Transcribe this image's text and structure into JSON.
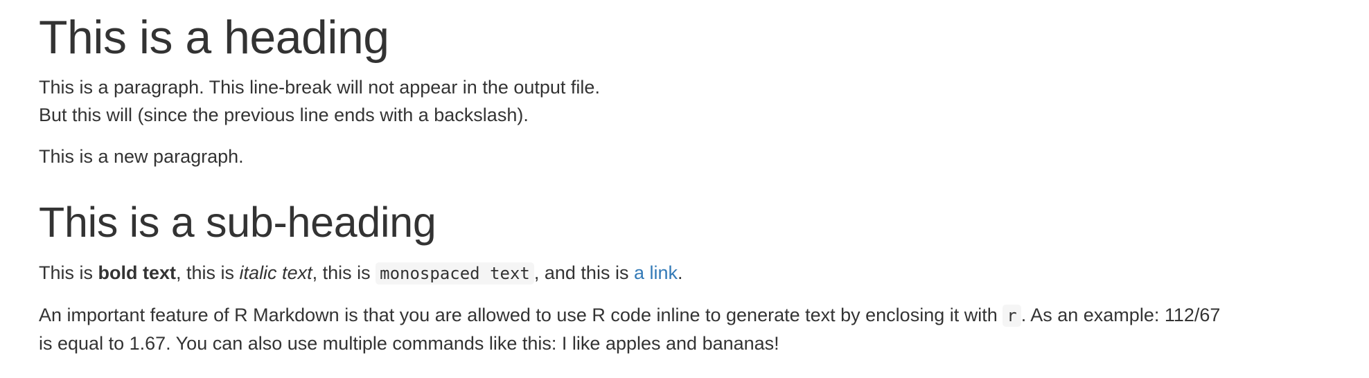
{
  "heading": "This is a heading",
  "para1": {
    "line1": "This is a paragraph. This line-break will not appear in the output file.",
    "line2": "But this will (since the previous line ends with a backslash)."
  },
  "para2": "This is a new paragraph.",
  "subheading": "This is a sub-heading",
  "para3": {
    "t1": "This is ",
    "bold": "bold text",
    "t2": ", this is ",
    "italic": "italic text",
    "t3": ", this is ",
    "code": "monospaced text",
    "t4": ", and this is ",
    "link": "a link",
    "t5": "."
  },
  "para4": {
    "t1": "An important feature of R Markdown is that you are allowed to use R code inline to generate text by enclosing it with ",
    "code": "r",
    "t2": ". As an example: 112/67",
    "line2": "is equal to 1.67. You can also use multiple commands like this: I like apples and bananas!"
  },
  "colors": {
    "text": "#333333",
    "link": "#337ab7",
    "code_bg": "#f5f5f5"
  }
}
